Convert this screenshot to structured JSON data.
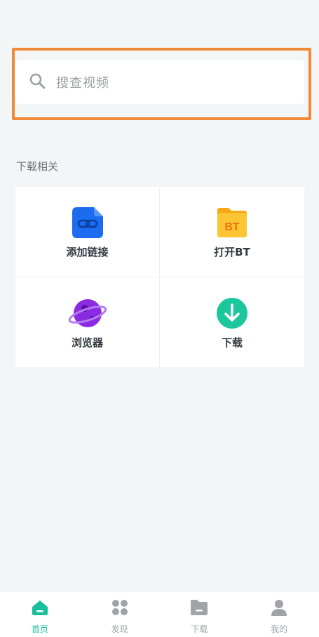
{
  "search": {
    "placeholder": "搜查视频",
    "icon": "search-icon"
  },
  "section": {
    "title": "下载相关"
  },
  "grid": [
    {
      "label": "添加链接",
      "icon": "link-file-icon",
      "color": "#1c6cf0"
    },
    {
      "label": "打开BT",
      "icon": "bt-folder-icon",
      "color": "#fbbd24",
      "icon_text": "BT"
    },
    {
      "label": "浏览器",
      "icon": "planet-icon",
      "color": "#8a2be2"
    },
    {
      "label": "下载",
      "icon": "download-icon",
      "color": "#1bc79b"
    }
  ],
  "tabbar": [
    {
      "label": "首页",
      "icon": "home-icon",
      "active": true
    },
    {
      "label": "发现",
      "icon": "discover-icon",
      "active": false
    },
    {
      "label": "下载",
      "icon": "folder-icon",
      "active": false
    },
    {
      "label": "我的",
      "icon": "user-icon",
      "active": false
    }
  ],
  "colors": {
    "accent": "#1bbf9c",
    "highlight": "#f08a3a",
    "inactive": "#a0a4a8"
  }
}
